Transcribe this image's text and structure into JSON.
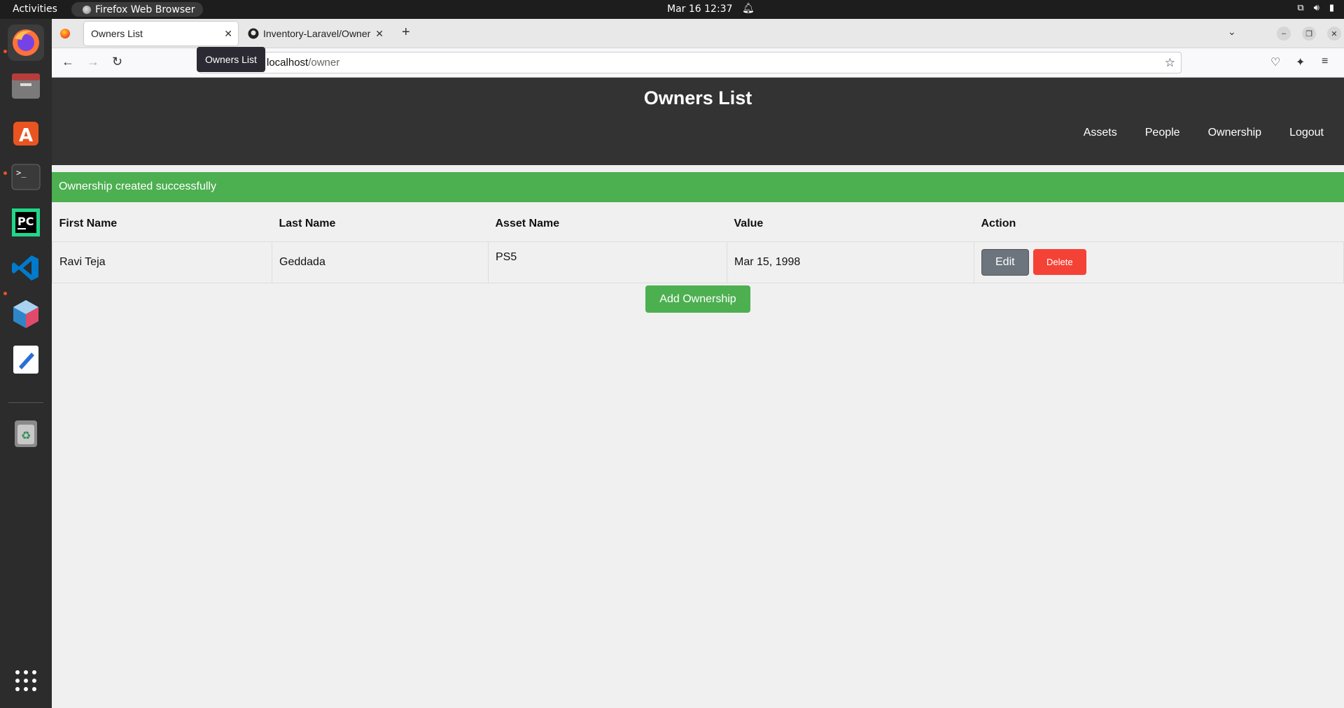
{
  "system": {
    "activities": "Activities",
    "app_name": "Firefox Web Browser",
    "clock": "Mar 16  12:37"
  },
  "browser": {
    "tabs": [
      {
        "label": "Owners List"
      },
      {
        "label": "Inventory-Laravel/Owner"
      }
    ],
    "url_host": "localhost",
    "url_path": "/owner",
    "tooltip": "Owners List"
  },
  "page": {
    "title": "Owners List",
    "nav": [
      "Assets",
      "People",
      "Ownership",
      "Logout"
    ],
    "alert": "Ownership created successfully",
    "table": {
      "headers": [
        "First Name",
        "Last Name",
        "Asset Name",
        "Value",
        "Action"
      ],
      "rows": [
        {
          "first_name": "Ravi Teja",
          "last_name": "Geddada",
          "asset_name": "PS5",
          "value": "Mar 15, 1998",
          "edit": "Edit",
          "delete": "Delete"
        }
      ]
    },
    "add_button": "Add Ownership"
  },
  "colors": {
    "header_bg": "#333333",
    "success": "#4caf50",
    "delete": "#f44336",
    "edit": "#6c757d"
  }
}
